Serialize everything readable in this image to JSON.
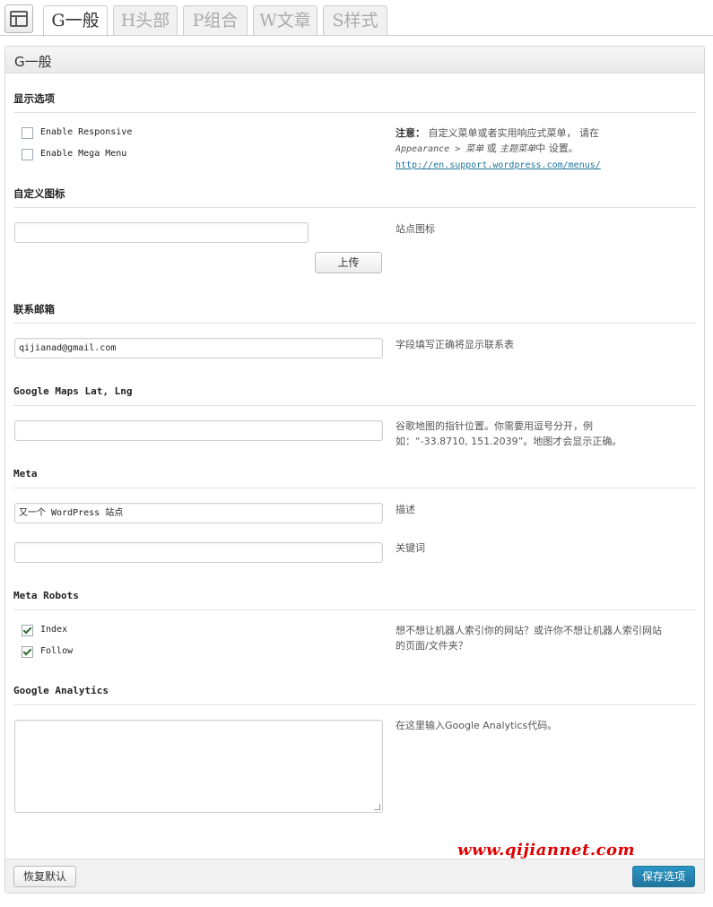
{
  "tabs": [
    {
      "label": "G一般",
      "active": true
    },
    {
      "label": "H头部",
      "active": false
    },
    {
      "label": "P组合",
      "active": false
    },
    {
      "label": "W文章",
      "active": false
    },
    {
      "label": "S样式",
      "active": false
    }
  ],
  "panel_title": "G一般",
  "display_options": {
    "title": "显示选项",
    "checkboxes": [
      {
        "label": "Enable Responsive",
        "checked": false
      },
      {
        "label": "Enable Mega Menu",
        "checked": false
      }
    ],
    "note": {
      "label": "注意：",
      "text": "自定义菜单或者实用响应式菜单， 请在",
      "path_pre": "Appearance > 菜单",
      "or": "或",
      "path_menu": "主题菜单",
      "suffix": "中 设置。",
      "link": "http://en.support.wordpress.com/menus/"
    }
  },
  "favicon": {
    "title": "自定义图标",
    "value": "",
    "upload_label": "上传",
    "desc": "站点图标"
  },
  "contact_email": {
    "title": "联系邮箱",
    "value": "qijianad@gmail.com",
    "desc": "字段填写正确将显示联系表"
  },
  "google_maps": {
    "title": "Google Maps Lat, Lng",
    "value": "",
    "desc": "谷歌地图的指针位置。你需要用逗号分开，例如：“-33.8710, 151.2039”。地图才会显示正确。"
  },
  "meta": {
    "title": "Meta",
    "description_value": "又一个 WordPress 站点",
    "description_label": "描述",
    "keywords_value": "",
    "keywords_label": "关键词"
  },
  "meta_robots": {
    "title": "Meta Robots",
    "checkboxes": [
      {
        "label": "Index",
        "checked": true
      },
      {
        "label": "Follow",
        "checked": true
      }
    ],
    "desc": "想不想让机器人索引你的网站？或许你不想让机器人索引网站的页面/文件夹？"
  },
  "google_analytics": {
    "title": "Google Analytics",
    "value": "",
    "desc": "在这里输入Google Analytics代码。"
  },
  "footer": {
    "reset_label": "恢复默认",
    "save_label": "保存选项"
  },
  "watermark": "www.qijiannet.com",
  "colors": {
    "primary_button": "#21759b",
    "link": "#21759b",
    "watermark": "#e00000"
  }
}
